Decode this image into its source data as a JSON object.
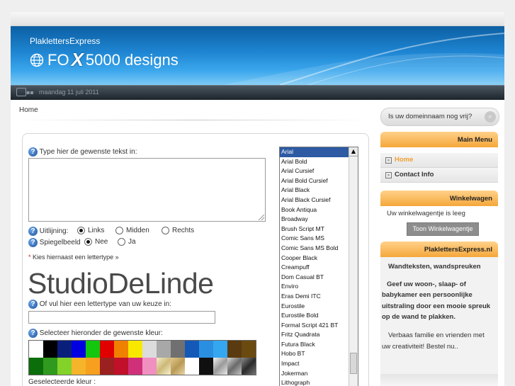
{
  "header": {
    "brand": "PlaklettersExpress",
    "logo_text_1": "FO",
    "logo_text_2": "5000 designs",
    "date": "maandag 11 juli 2011"
  },
  "breadcrumb": "Home",
  "form": {
    "text_label": "Type hier de gewenste tekst in:",
    "alignment_label": "Uitlijning:",
    "align_options": [
      "Links",
      "Midden",
      "Rechts"
    ],
    "align_selected": "Links",
    "mirror_label": "Spiegelbeeld",
    "mirror_options": [
      "Nee",
      "Ja"
    ],
    "mirror_selected": "Nee",
    "font_hint": "Kies hiernaast een lettertype »",
    "preview_text": "StudioDeLinde",
    "own_font_label": "Of vul hier een lettertype van uw keuze in:",
    "color_label": "Selecteer hieronder de gewenste kleur:",
    "selected_color_label": "Geselecteerde kleur :",
    "palette": [
      "#ffffff",
      "#000000",
      "#0a1f7a",
      "#0000e0",
      "#13c60e",
      "#e00000",
      "#f08000",
      "#f8e800",
      "#dcdcdc",
      "#a8a8a8",
      "#707070",
      "#1559b8",
      "#2a8fe0",
      "#35a6f0",
      "#5a3a10",
      "#6b4a10",
      "#0b6e0b",
      "#2f9a1d",
      "#82d22a",
      "#f5b42a",
      "#f7a020",
      "#9b2020",
      "#c0102a",
      "#d0307a",
      "#f090c0",
      "#e8e0b8",
      "#d8c088",
      "#ffffff",
      "#101010",
      "#c0c0c0",
      "#909090",
      "#505050"
    ],
    "fonts": [
      "Arial",
      "Arial Bold",
      "Arial Cursief",
      "Arial Bold Cursief",
      "Arial Black",
      "Arial Black Cursief",
      "Book Antiqua",
      "Broadway",
      "Brush Script MT",
      "Comic Sans MS",
      "Comic Sans MS Bold",
      "Cooper Black",
      "Creampuff",
      "Dom Casual BT",
      "Enviro",
      "Eras Demi ITC",
      "Eurostile",
      "Eurostile Bold",
      "Formal Script 421 BT",
      "Fritz Quadrata",
      "Futura Black",
      "Hobo BT",
      "Impact",
      "Jokerman",
      "Lithograph"
    ],
    "font_selected": "Arial"
  },
  "sidebar": {
    "search_placeholder": "Is uw domeinnaam nog vrij?",
    "main_menu_title": "Main Menu",
    "menu_items": [
      {
        "label": "Home",
        "color": "#f0a030"
      },
      {
        "label": "Contact Info",
        "color": "#333333"
      }
    ],
    "cart_title": "Winkelwagen",
    "cart_text": "Uw winkelwagentje is leeg",
    "cart_button": "Toon Winkelwagentje",
    "about_title": "PlaklettersExpress.nl",
    "about_heading": "Wandteksten, wandspreuken",
    "about_bold_1": "Geef uw woon-, slaap- of",
    "about_bold_2": "babykamer een persoonlijke",
    "about_bold_3": "uitstraling door een mooie spreuk",
    "about_bold_4": "op de wand te plakken.",
    "about_text_1": "Verbaas familie en vrienden met",
    "about_text_2": "uw creativiteit! Bestel nu.."
  }
}
